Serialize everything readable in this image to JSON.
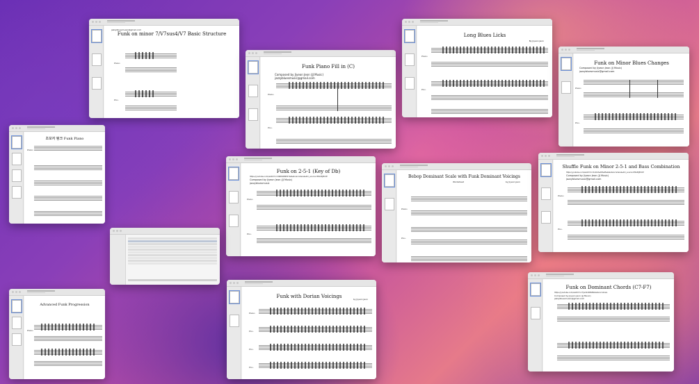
{
  "windows": {
    "w1": {
      "title": "Funk on minor 7/V7sus4/V7 Basic Structure",
      "email": "jazzybluesmusic@gmail.com",
      "labels": [
        "Piano",
        "Pno."
      ]
    },
    "w2": {
      "title": "Funk Piano Fill in (C)",
      "composer": "Composed by Jiyeon Jeon (JJ Music)",
      "email": "jazzybluesmusic@gmail.com",
      "labels": [
        "Piano",
        "Pno."
      ]
    },
    "w3": {
      "title": "Long Blues Licks",
      "author": "By Jiyeon Jeon",
      "labels": [
        "Piano",
        "Pno."
      ]
    },
    "w4": {
      "title": "Funk on Minor Blues Changes",
      "composer": "Composed by Jiyeon Jeon (JJ Music)",
      "email": "jazzybluesmusic@gmail.com",
      "labels": [
        "Piano",
        "Pno."
      ]
    },
    "w5": {
      "title": "초보자 펑크 Funk Piano",
      "labels": [
        "Piano"
      ]
    },
    "w6": {
      "title": "Funk on 2-5-1 (Key of Db)",
      "url": "https://youtube.com/watch?v=0W6SM9M1Y&feature=share&utm_source=EKLEiJECCE",
      "composer": "Composed by Jiyeon Jeon (JJ Music)",
      "email": "jazzybluesmusic",
      "labels": [
        "Piano",
        "Pno."
      ]
    },
    "w7": {
      "title": "Bebop Dominant Scale with Funk Dominant Voicings",
      "author": "by Jiyeon Jeon",
      "sub": "Worksheet",
      "labels": [
        "Piano",
        "Pno."
      ]
    },
    "w8": {
      "title": "Shuffle Funk on Minor 2-5-1 and Bass Combination",
      "url": "https://youtube.com/watch?v=Xo1lbhwWSetfw&feature=share&utm_source=EKLEiJECCE",
      "composer": "Composed by Jiyeon Jeon (JJ Music)",
      "email": "jazzybluesmusic@gmail.com",
      "labels": [
        "Piano",
        "Pno."
      ]
    },
    "w9": {
      "title": "Advanced Funk Progression",
      "labels": [
        "Piano"
      ]
    },
    "w10": {
      "title": "Funk with Dorian Voicings",
      "author": "by Jiyeon Jeon",
      "labels": [
        "Piano",
        "Pno.",
        "Pno.",
        "Pno."
      ]
    },
    "w11": {
      "title": "Funk on Dominant Chords (C7-F7)",
      "url": "https://youtube.com/watch?v=Tjad1d96SE&feature=share",
      "composer": "Composed by Jiyeon Jeon (JJ Music)",
      "email": "jazzybluesmusic@gmail.com",
      "labels": []
    }
  },
  "colors": {
    "accent": "#6a8fd9"
  }
}
